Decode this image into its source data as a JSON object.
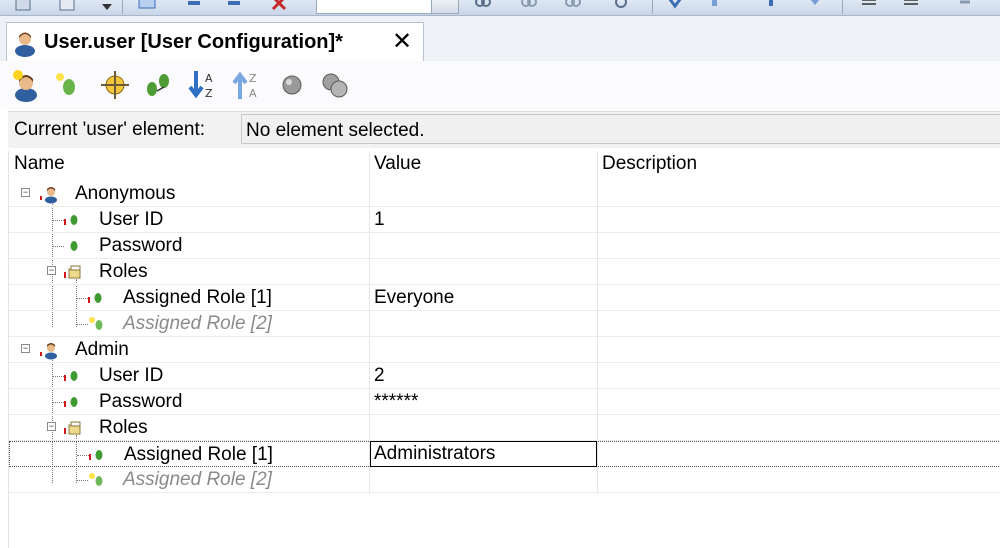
{
  "editor_tab": {
    "title": "User.user [User Configuration]*",
    "close_glyph": "✕"
  },
  "current_element": {
    "label": "Current 'user' element:",
    "value": "No element selected."
  },
  "columns": {
    "name": "Name",
    "value": "Value",
    "description": "Description"
  },
  "tree": {
    "anonymous": {
      "label": "Anonymous",
      "user_id": {
        "label": "User ID",
        "value": "1"
      },
      "password": {
        "label": "Password",
        "value": ""
      },
      "roles": {
        "label": "Roles",
        "role1": {
          "label": "Assigned Role [1]",
          "value": "Everyone"
        },
        "role2": {
          "label": "Assigned Role [2]"
        }
      }
    },
    "admin": {
      "label": "Admin",
      "user_id": {
        "label": "User ID",
        "value": "2"
      },
      "password": {
        "label": "Password",
        "value": "******"
      },
      "roles": {
        "label": "Roles",
        "role1": {
          "label": "Assigned Role [1]",
          "value": "Administrators"
        },
        "role2": {
          "label": "Assigned Role [2]"
        }
      }
    }
  },
  "colors": {
    "accent_blue": "#2f6fc4",
    "required_red": "#d01818",
    "leaf_green": "#3f9a32",
    "placeholder_gray": "#8a8a8a"
  },
  "icons": {
    "tab": "user-icon",
    "toolbar": [
      "add-user-icon",
      "add-element-icon",
      "target-icon",
      "expand-collapse-icon",
      "sort-ascending-icon",
      "sort-descending-icon",
      "circle-icon",
      "gears-icon"
    ]
  }
}
